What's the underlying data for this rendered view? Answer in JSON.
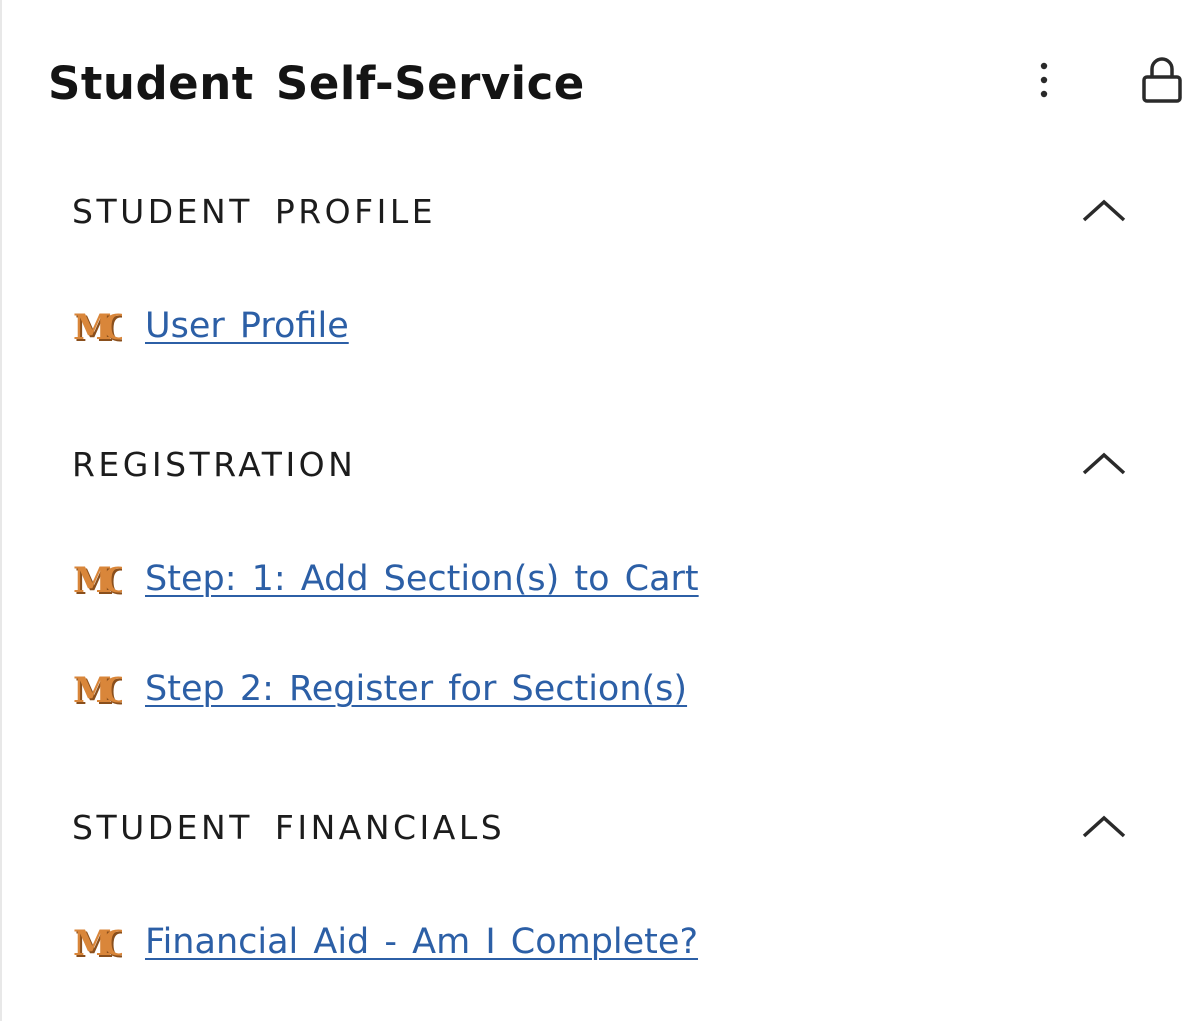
{
  "header": {
    "title": "Student Self-Service",
    "menu_icon": "more-vertical-icon",
    "lock_icon": "lock-icon"
  },
  "colors": {
    "link": "#2c5fa6",
    "text": "#141414",
    "logo_orange": "#d9863a",
    "logo_shadow": "#8a4f1c"
  },
  "sections": [
    {
      "title": "STUDENT PROFILE",
      "expanded": true,
      "links": [
        {
          "logo": "MC",
          "label": "User Profile"
        }
      ]
    },
    {
      "title": "REGISTRATION",
      "expanded": true,
      "links": [
        {
          "logo": "MC",
          "label": "Step: 1: Add Section(s) to Cart"
        },
        {
          "logo": "MC",
          "label": "Step 2: Register for Section(s)"
        }
      ]
    },
    {
      "title": "STUDENT FINANCIALS",
      "expanded": true,
      "links": [
        {
          "logo": "MC",
          "label": "Financial Aid - Am I Complete?"
        }
      ]
    }
  ]
}
